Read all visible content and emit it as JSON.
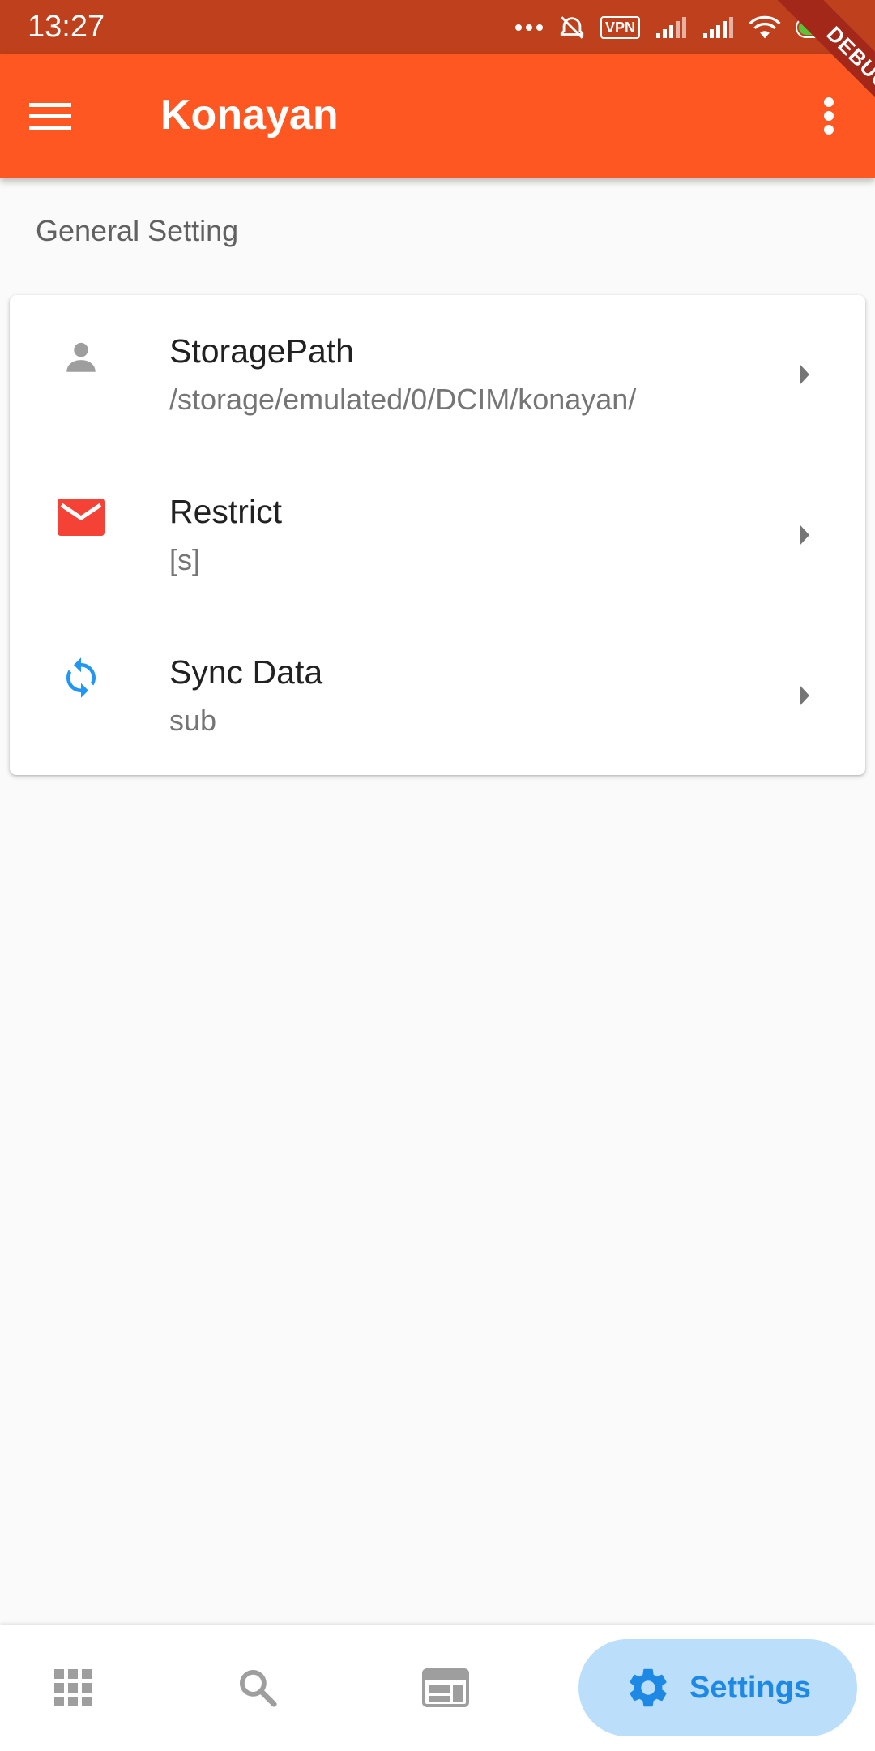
{
  "status_bar": {
    "time": "13:27",
    "vpn": "VPN",
    "battery_level": "85",
    "battery_color": "#57c43a"
  },
  "app_bar": {
    "title": "Konayan",
    "background": "#ff5722"
  },
  "debug_banner": "DEBUG",
  "section": {
    "title": "General Setting"
  },
  "settings": [
    {
      "icon": "person-icon",
      "icon_color": "#9e9e9e",
      "title": "StoragePath",
      "subtitle": "/storage/emulated/0/DCIM/konayan/"
    },
    {
      "icon": "mail-icon",
      "icon_color": "#f44336",
      "title": "Restrict",
      "subtitle": "[s]"
    },
    {
      "icon": "sync-icon",
      "icon_color": "#2196f3",
      "title": "Sync Data",
      "subtitle": "sub"
    }
  ],
  "bottom_nav": {
    "items": [
      {
        "icon": "grid-icon"
      },
      {
        "icon": "search-icon"
      },
      {
        "icon": "web-icon"
      },
      {
        "icon": "settings-icon",
        "label": "Settings",
        "active": true
      }
    ],
    "active_color": "#1e88e5",
    "active_background": "#bbdefb"
  }
}
